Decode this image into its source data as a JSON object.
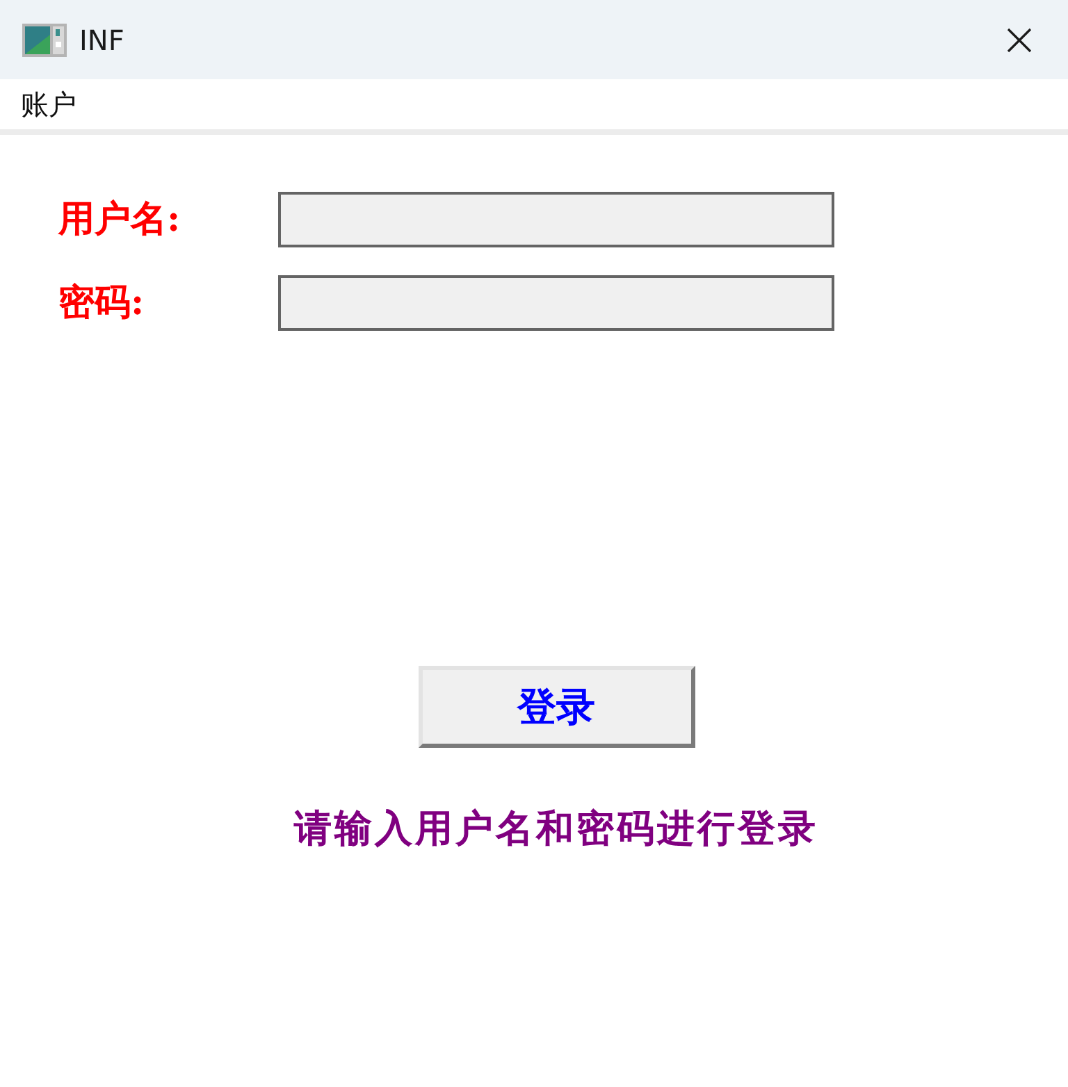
{
  "window": {
    "title": "INF"
  },
  "menu": [
    {
      "label": "账户"
    }
  ],
  "form": {
    "fields": [
      {
        "label": "用户名:"
      },
      {
        "label": "密码:"
      }
    ]
  },
  "buttons": [
    {
      "label": "登录"
    }
  ],
  "status_message": "请输入用户名和密码进行登录"
}
